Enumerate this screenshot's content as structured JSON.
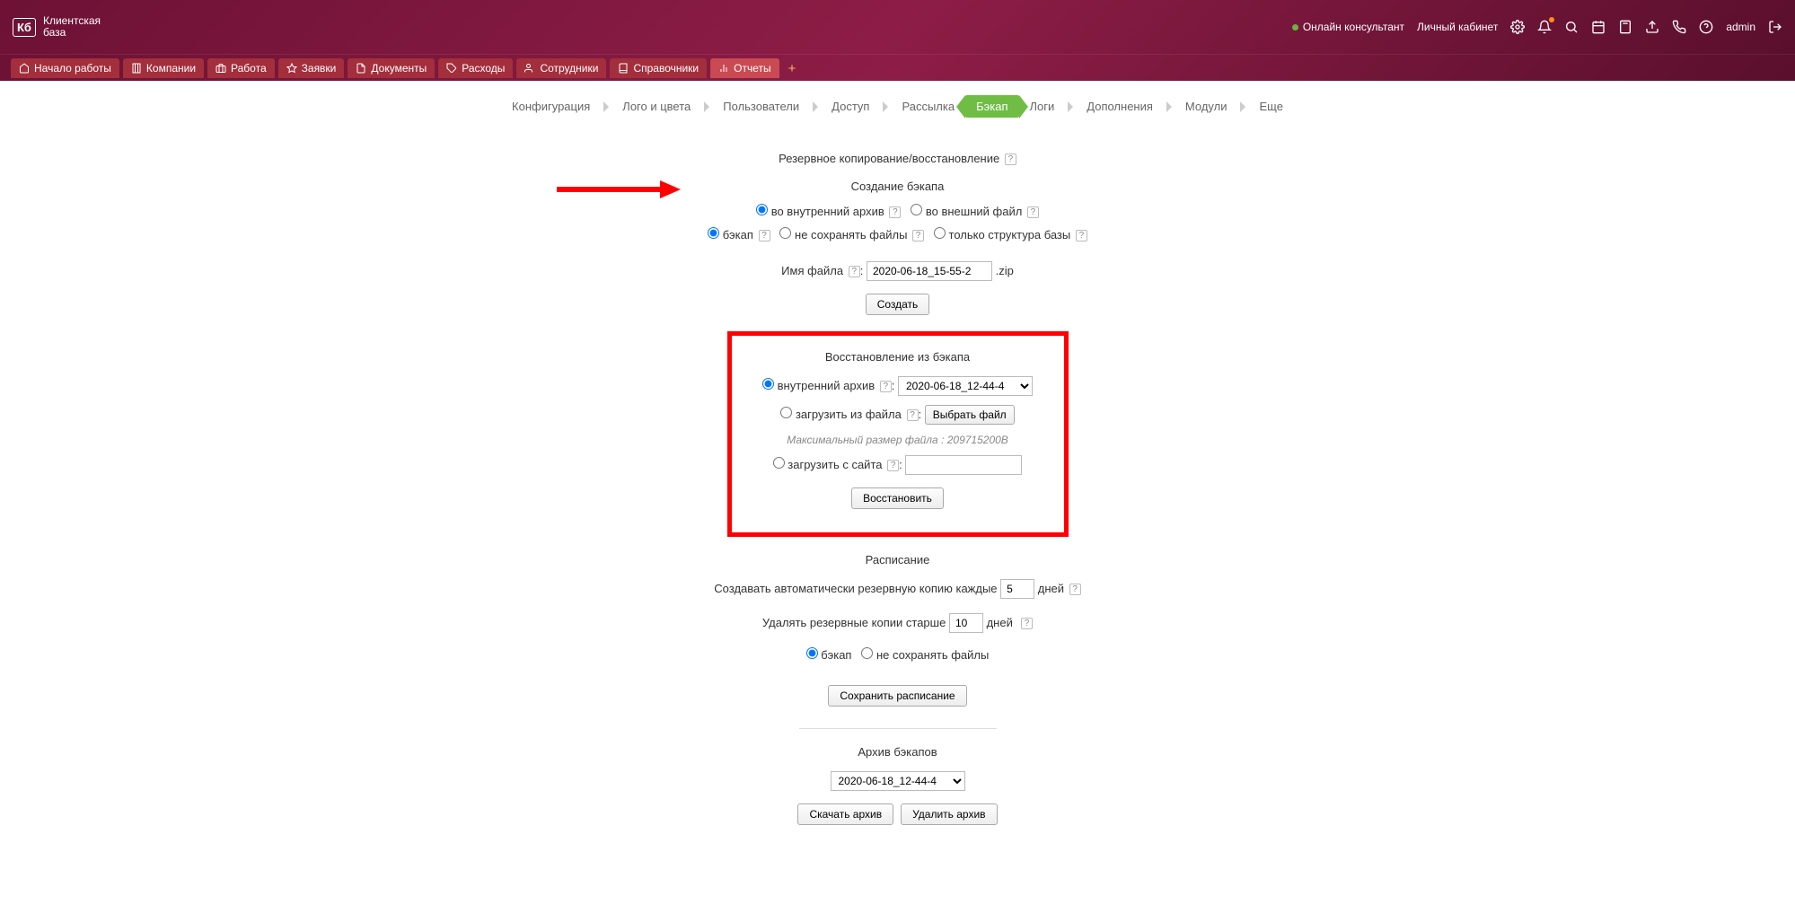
{
  "brand": {
    "logo": "Кб",
    "name": "Клиентская\nбаза"
  },
  "topright": {
    "online": "Онлайн консультант",
    "cabinet": "Личный кабинет",
    "user": "admin"
  },
  "nav": [
    {
      "label": "Начало работы"
    },
    {
      "label": "Компании"
    },
    {
      "label": "Работа"
    },
    {
      "label": "Заявки"
    },
    {
      "label": "Документы"
    },
    {
      "label": "Расходы"
    },
    {
      "label": "Сотрудники"
    },
    {
      "label": "Справочники"
    },
    {
      "label": "Отчеты"
    }
  ],
  "subnav": [
    "Конфигурация",
    "Лого и цвета",
    "Пользователи",
    "Доступ",
    "Рассылка",
    "Бэкап",
    "Логи",
    "Дополнения",
    "Модули",
    "Еще"
  ],
  "subnav_active": "Бэкап",
  "section": {
    "title1": "Резервное копирование/восстановление",
    "create_title": "Создание бэкапа",
    "dest": {
      "internal": "во внутренний архив",
      "external": "во внешний файл"
    },
    "mode": {
      "backup": "бэкап",
      "nofiles": "не сохранять файлы",
      "structure": "только структура базы"
    },
    "filename_label": "Имя файла",
    "filename_value": "2020-06-18_15-55-2",
    "filename_ext": ".zip",
    "create_btn": "Создать",
    "restore_title": "Восстановление из бэкапа",
    "restore": {
      "internal_label": "внутренний архив",
      "internal_value": "2020-06-18_12-44-4",
      "upload_label": "загрузить из файла",
      "choose_btn": "Выбрать файл",
      "max_file": "Максимальный размер файла : 209715200B",
      "site_label": "загрузить с сайта",
      "restore_btn": "Восстановить"
    },
    "schedule_title": "Расписание",
    "schedule_line1_pre": "Создавать автоматически резервную копию каждые",
    "schedule_line1_val": "5",
    "schedule_line1_post": "дней",
    "schedule_line2_pre": "Удалять резервные копии старше",
    "schedule_line2_val": "10",
    "schedule_line2_post": "дней",
    "schedule_mode": {
      "backup": "бэкап",
      "nofiles": "не сохранять файлы"
    },
    "save_schedule_btn": "Сохранить расписание",
    "archive_title": "Архив бэкапов",
    "archive_value": "2020-06-18_12-44-4",
    "download_btn": "Скачать архив",
    "delete_btn": "Удалить архив"
  }
}
